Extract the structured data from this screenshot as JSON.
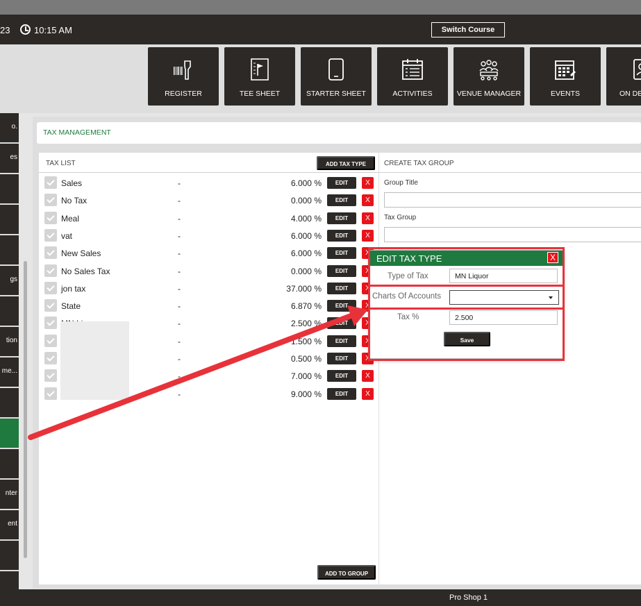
{
  "header": {
    "date_fragment": "23",
    "time": "10:15 AM",
    "switch_course_label": "Switch Course"
  },
  "nav_tiles": [
    {
      "label": "REGISTER",
      "icon": "barcode-scanner-icon"
    },
    {
      "label": "TEE SHEET",
      "icon": "flag-sheet-icon"
    },
    {
      "label": "STARTER SHEET",
      "icon": "tablet-icon"
    },
    {
      "label": "ACTIVITIES",
      "icon": "calendar-list-icon"
    },
    {
      "label": "VENUE MANAGER",
      "icon": "people-table-icon"
    },
    {
      "label": "EVENTS",
      "icon": "calendar-grid-icon"
    },
    {
      "label": "ON DE",
      "icon": "person-device-icon"
    }
  ],
  "sidebar_items": [
    "o.",
    "es",
    "",
    "",
    "",
    "gs",
    "",
    "tion",
    "me...",
    "",
    "",
    "",
    "nter",
    "ent",
    "",
    ""
  ],
  "section_title": "TAX MANAGEMENT",
  "tax_list": {
    "title": "TAX LIST",
    "add_tax_type_label": "ADD TAX TYPE",
    "add_to_group_label": "ADD TO GROUP",
    "edit_label": "EDIT",
    "delete_label": "X",
    "dash": "-",
    "rows": [
      {
        "name": "Sales",
        "value": "6.000 %"
      },
      {
        "name": "No Tax",
        "value": "0.000 %"
      },
      {
        "name": "Meal",
        "value": "4.000 %"
      },
      {
        "name": "vat",
        "value": "6.000 %"
      },
      {
        "name": "New Sales",
        "value": "6.000 %"
      },
      {
        "name": "No Sales Tax",
        "value": "0.000 %"
      },
      {
        "name": "jon tax",
        "value": "37.000 %"
      },
      {
        "name": "State",
        "value": "6.870 %"
      },
      {
        "name": "MN Li",
        "value": "2.500 %"
      },
      {
        "name": "",
        "value": "1.500 %"
      },
      {
        "name": "",
        "value": "0.500 %"
      },
      {
        "name": "",
        "value": "7.000 %"
      },
      {
        "name": "",
        "value": "9.000 %"
      }
    ]
  },
  "create_tax_group": {
    "title": "CREATE TAX GROUP",
    "group_title_label": "Group Title",
    "tax_group_label": "Tax Group"
  },
  "edit_modal": {
    "title": "EDIT TAX TYPE",
    "close_label": "X",
    "type_of_tax_label": "Type of Tax",
    "type_of_tax_value": "MN Liquor",
    "charts_of_accounts_label": "Charts Of Accounts",
    "charts_of_accounts_value": "",
    "tax_pct_label": "Tax %",
    "tax_pct_value": "2.500",
    "save_label": "Save"
  },
  "footer": {
    "location": "Pro Shop 1"
  },
  "colors": {
    "dark": "#2d2926",
    "green": "#1e7a3e",
    "red": "#e8141b",
    "highlight": "#e8323a"
  }
}
